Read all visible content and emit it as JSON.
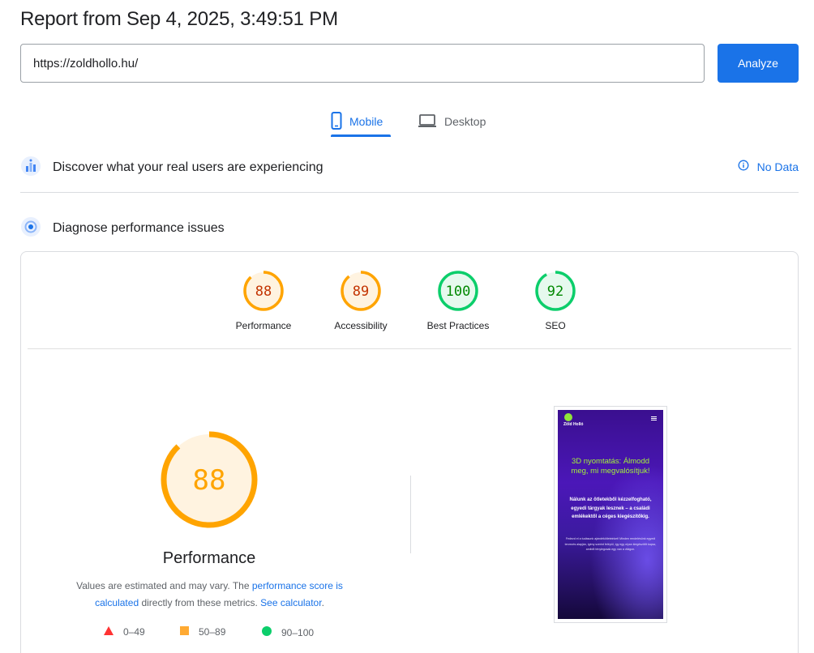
{
  "header": {
    "report_title": "Report from Sep 4, 2025, 3:49:51 PM"
  },
  "search": {
    "url_value": "https://zoldhollo.hu/",
    "analyze_label": "Analyze"
  },
  "tabs": [
    {
      "label": "Mobile",
      "icon": "phone-icon",
      "selected": true
    },
    {
      "label": "Desktop",
      "icon": "laptop-icon",
      "selected": false
    }
  ],
  "field_data": {
    "title": "Discover what your real users are experiencing",
    "status_label": "No Data"
  },
  "diagnose": {
    "title": "Diagnose performance issues"
  },
  "scores": [
    {
      "label": "Performance",
      "value": 88,
      "status": "average"
    },
    {
      "label": "Accessibility",
      "value": 89,
      "status": "average"
    },
    {
      "label": "Best Practices",
      "value": 100,
      "status": "pass"
    },
    {
      "label": "SEO",
      "value": 92,
      "status": "pass"
    }
  ],
  "performance": {
    "score": 88,
    "title": "Performance",
    "description_prefix": "Values are estimated and may vary. The ",
    "link_score": "performance score is calculated",
    "description_middle": " directly from these metrics. ",
    "link_calculator": "See calculator",
    "description_suffix": "."
  },
  "legend": [
    {
      "range": "0–49",
      "shape": "triangle",
      "color": "#ff3333"
    },
    {
      "range": "50–89",
      "shape": "square",
      "color": "#ffaa33"
    },
    {
      "range": "90–100",
      "shape": "circle",
      "color": "#0cce6b"
    }
  ],
  "colors": {
    "accent": "#1a73e8",
    "average_stroke": "#ffa400",
    "average_text": "#c33300",
    "average_fill": "#fff3e0",
    "pass_stroke": "#0cce6b",
    "pass_text": "#008800",
    "pass_fill": "#e6f9ee"
  },
  "screenshot": {
    "brand": "Zöld Holló",
    "headline": "3D nyomtatás: Álmodd meg, mi megvalósítjuk!",
    "subtext": "Nálunk az ötletekből kézzelfogható, egyedi tárgyak lesznek – a családi emlékektől a céges kiegészítőkig.",
    "small_text": "Fedezd el a tudásunk ajándékötleteinket! Minden rendelésünk egyedi tervezés alapján, igény szerint felépül, így egy olyan kiegészítőt kapsz, amiből ténylegcsak egy van a világon."
  }
}
